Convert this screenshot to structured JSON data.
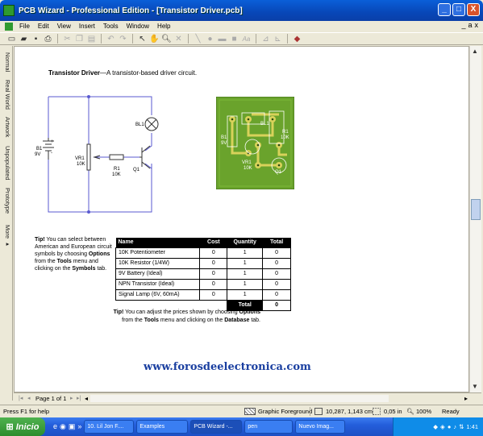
{
  "window": {
    "title": "PCB Wizard - Professional Edition - [Transistor Driver.pcb]",
    "buttons": {
      "minimize": "_",
      "maximize": "□",
      "close": "X"
    }
  },
  "menu": {
    "items": [
      "File",
      "Edit",
      "View",
      "Insert",
      "Tools",
      "Window",
      "Help"
    ],
    "mdi_buttons": [
      "_",
      "a",
      "x"
    ]
  },
  "toolbar": {
    "icons": [
      "new-icon",
      "open-icon",
      "save-icon",
      "print-icon",
      "cut-icon",
      "copy-icon",
      "paste-icon",
      "undo-icon",
      "redo-icon",
      "select-icon",
      "pan-icon",
      "zoom-icon",
      "delete-icon",
      "line-icon",
      "pad-icon",
      "track-icon",
      "square-icon",
      "text-icon",
      "measure-icon",
      "dimension-icon",
      "component-icon"
    ]
  },
  "sidetabs": [
    "Normal",
    "Real World",
    "Artwork",
    "Unpopulated",
    "Prototype",
    "More ▸"
  ],
  "document": {
    "heading_bold": "Transistor Driver",
    "heading_rest": "—A transistor-based driver circuit.",
    "schematic": {
      "b1_label": "B1",
      "b1_value": "9V",
      "vr1_label": "VR1",
      "vr1_value": "10K",
      "r1_label": "R1",
      "r1_value": "10K",
      "q1_label": "Q1",
      "bl1_label": "BL1",
      "plus": "+",
      "minus": "-"
    },
    "pcb": {
      "b1_label": "B1",
      "b1_value": "9V",
      "vr1_label": "VR1",
      "vr1_value": "10K",
      "r1_label": "R1",
      "r1_value": "10K",
      "bl1_label": "BL1",
      "q1_label": "Q1"
    },
    "tip1": {
      "prefix": "Tip!",
      "line1": " You can select between",
      "line2": "American and European circuit",
      "line3": "symbols by choosing ",
      "options": "Options",
      "line4": "from the ",
      "tools": "Tools",
      "line4b": " menu and",
      "line5": "clicking on the ",
      "symbols": "Symbols",
      "line5b": " tab."
    },
    "bom": {
      "headers": [
        "Name",
        "Cost",
        "Quantity",
        "Total"
      ],
      "rows": [
        [
          "10K Potentiometer",
          "0",
          "1",
          "0"
        ],
        [
          "10K Resistor (1/4W)",
          "0",
          "1",
          "0"
        ],
        [
          "9V Battery (Ideal)",
          "0",
          "1",
          "0"
        ],
        [
          "NPN Transistor (Ideal)",
          "0",
          "1",
          "0"
        ],
        [
          "Signal Lamp (6V, 60mA)",
          "0",
          "1",
          "0"
        ]
      ],
      "total_label": "Total",
      "total_value": "0"
    },
    "tip2": {
      "prefix": "Tip!",
      "line1": " You can adjust the prices shown by choosing ",
      "options": "Options",
      "line2a": "from the ",
      "tools": "Tools",
      "line2b": " menu and clicking on the ",
      "database": "Database",
      "line2c": " tab."
    },
    "watermark": "www.forosdeelectronica.com"
  },
  "pagebar": {
    "label": "Page 1 of 1"
  },
  "statusbar": {
    "help": "Press F1 for help",
    "layer": "Graphic Foreground",
    "coords": "10,287, 1,143 cm",
    "grid": "0,05 in",
    "zoom": "100%",
    "state": "Ready"
  },
  "taskbar": {
    "start": "Inicio",
    "tasks": [
      "10. Lil Jon F....",
      "Examples",
      "PCB Wizard -...",
      "pen",
      "Nuevo Imag..."
    ],
    "clock": "1:41"
  },
  "colors": {
    "pcb_board": "#6aa32c",
    "pcb_copper": "#d8d25a",
    "title_blue": "#0a5fd8",
    "watermark": "#1a3fa0"
  }
}
